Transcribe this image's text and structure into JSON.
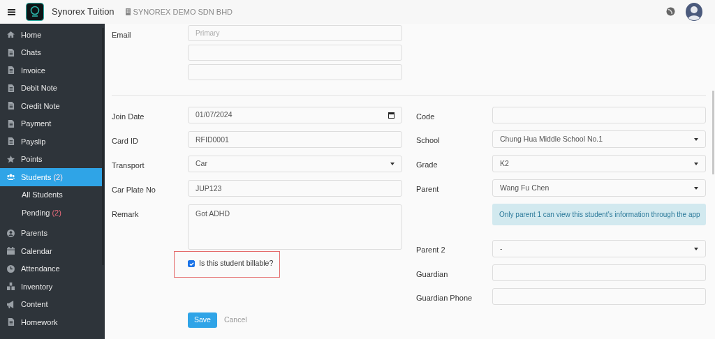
{
  "header": {
    "app_name": "Synorex Tuition",
    "company": "SYNOREX DEMO SDN BHD"
  },
  "sidebar": {
    "items": [
      {
        "label": "Home",
        "kind": "home",
        "selected": false
      },
      {
        "label": "Chats",
        "kind": "doc",
        "selected": false
      },
      {
        "label": "Invoice",
        "kind": "doc",
        "selected": false
      },
      {
        "label": "Debit Note",
        "kind": "doc",
        "selected": false
      },
      {
        "label": "Credit Note",
        "kind": "doc",
        "selected": false
      },
      {
        "label": "Payment",
        "kind": "doc",
        "selected": false
      },
      {
        "label": "Payslip",
        "kind": "doc",
        "selected": false
      },
      {
        "label": "Points",
        "kind": "star",
        "selected": false
      },
      {
        "label": "Students",
        "kind": "users",
        "badge": "(2)",
        "selected": true,
        "children": [
          {
            "label": "All Students",
            "selected": false
          },
          {
            "label": "Pending",
            "badge": "(2)",
            "selected": false
          }
        ]
      },
      {
        "label": "Parents",
        "kind": "user",
        "selected": false
      },
      {
        "label": "Calendar",
        "kind": "calendar",
        "selected": false
      },
      {
        "label": "Attendance",
        "kind": "clock",
        "selected": false
      },
      {
        "label": "Inventory",
        "kind": "boxes",
        "selected": false
      },
      {
        "label": "Content",
        "kind": "megaphone",
        "selected": false
      },
      {
        "label": "Homework",
        "kind": "doc",
        "selected": false
      }
    ]
  },
  "email": {
    "label": "Email",
    "fields": [
      {
        "kind": "primary",
        "placeholder": "Primary"
      },
      {
        "kind": "extra"
      },
      {
        "kind": "extra"
      }
    ]
  },
  "left_fields": [
    {
      "kind": "date",
      "label": "Join Date",
      "value": "01/07/2024"
    },
    {
      "kind": "text",
      "label": "Card ID",
      "value": "RFID0001"
    },
    {
      "kind": "select",
      "label": "Transport",
      "value": "Car"
    },
    {
      "kind": "text",
      "label": "Car Plate No",
      "value": "JUP123"
    },
    {
      "kind": "textarea",
      "label": "Remark",
      "value": "Got ADHD"
    },
    {
      "kind": "checkbox",
      "label": "Is this student billable?",
      "checked": true,
      "highlighted": true
    }
  ],
  "right_fields": [
    {
      "kind": "text",
      "label": "Code"
    },
    {
      "kind": "select",
      "label": "School",
      "value": "Chung Hua Middle School No.1"
    },
    {
      "kind": "select",
      "label": "Grade",
      "value": "K2"
    },
    {
      "kind": "select",
      "label": "Parent",
      "value": "Wang Fu Chen"
    },
    {
      "kind": "alert",
      "text": "Only parent 1 can view this student's information through the app"
    },
    {
      "kind": "select",
      "label": "Parent 2",
      "value": "-"
    },
    {
      "kind": "text",
      "label": "Guardian"
    },
    {
      "kind": "text",
      "label": "Guardian Phone"
    }
  ],
  "buttons": [
    {
      "kind": "primary",
      "label": "Save"
    },
    {
      "kind": "link",
      "label": "Cancel"
    }
  ]
}
